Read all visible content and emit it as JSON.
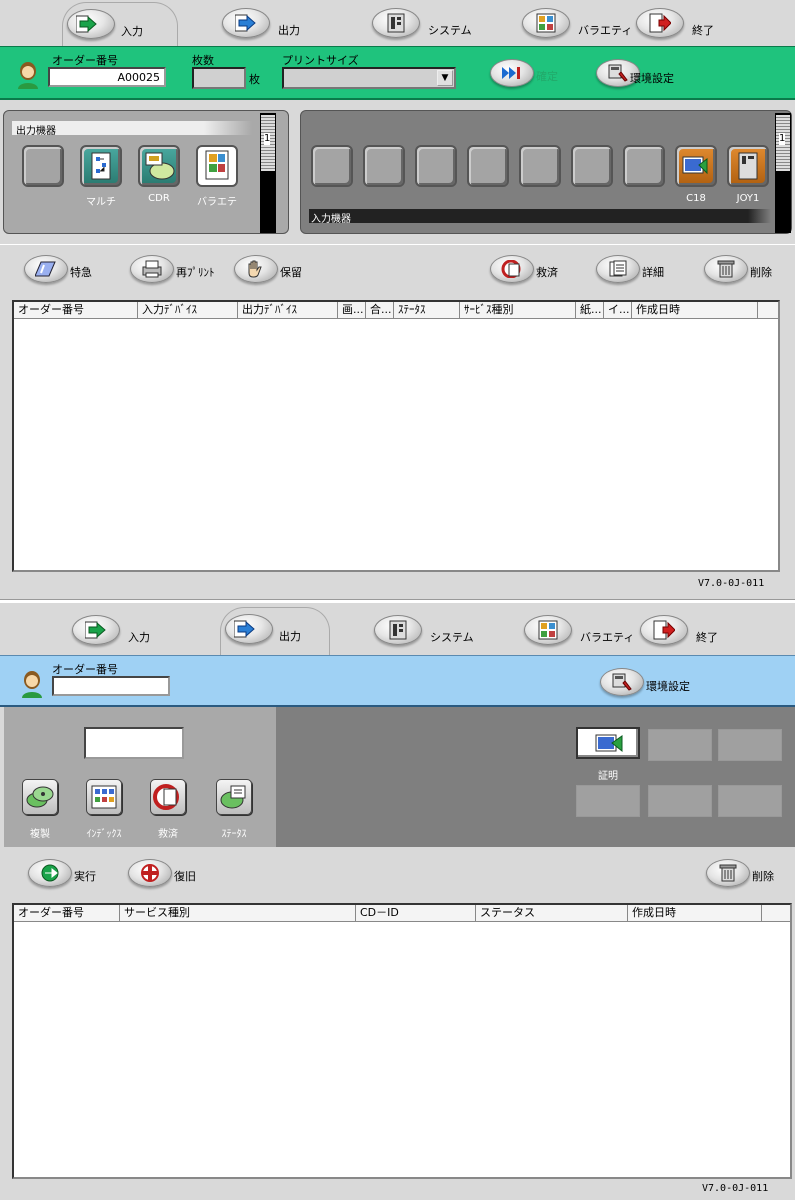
{
  "screen1": {
    "tabs": [
      {
        "label": "入力",
        "icon": "input-arrow-icon"
      },
      {
        "label": "出力",
        "icon": "output-arrow-icon"
      },
      {
        "label": "システム",
        "icon": "system-icon"
      },
      {
        "label": "バラエティ",
        "icon": "variety-icon"
      },
      {
        "label": "終了",
        "icon": "exit-icon"
      }
    ],
    "order": {
      "label": "オーダー番号",
      "value": "A00025"
    },
    "sheets": {
      "label": "枚数",
      "unit": "枚",
      "value": ""
    },
    "print_size": {
      "label": "プリントサイズ",
      "value": ""
    },
    "dim_button": {
      "label": "確定"
    },
    "env_button": {
      "label": "環境設定"
    },
    "output_devices": {
      "title": "出力機器",
      "items": [
        {
          "label": "",
          "icon": "blank-device-icon"
        },
        {
          "label": "マルチ",
          "icon": "multi-icon"
        },
        {
          "label": "CDR",
          "icon": "cdr-icon"
        },
        {
          "label": "バラエテ",
          "icon": "variety-icon"
        }
      ],
      "scroll_value": "1"
    },
    "input_devices": {
      "title": "入力機器",
      "items": [
        {
          "label": ""
        },
        {
          "label": ""
        },
        {
          "label": ""
        },
        {
          "label": ""
        },
        {
          "label": ""
        },
        {
          "label": ""
        },
        {
          "label": ""
        },
        {
          "label": "C18"
        },
        {
          "label": "JOY1"
        }
      ],
      "scroll_value": "1"
    },
    "actions": [
      {
        "label": "特急",
        "icon": "express-icon"
      },
      {
        "label": "再ﾌﾟﾘﾝﾄ",
        "icon": "reprint-icon"
      },
      {
        "label": "保留",
        "icon": "hold-hand-icon"
      },
      {
        "label": "救済",
        "icon": "rescue-icon"
      },
      {
        "label": "詳細",
        "icon": "detail-icon"
      },
      {
        "label": "削除",
        "icon": "trash-icon"
      }
    ],
    "table_headers": [
      "オーダー番号",
      "入力ﾃﾞﾊﾞｲｽ",
      "出力ﾃﾞﾊﾞｲｽ",
      "画...",
      "合...",
      "ｽﾃｰﾀｽ",
      "ｻｰﾋﾞｽ種別",
      "紙...",
      "イ...",
      "作成日時"
    ],
    "version": "V7.0-0J-011"
  },
  "screen2": {
    "tabs": [
      {
        "label": "入力"
      },
      {
        "label": "出力"
      },
      {
        "label": "システム"
      },
      {
        "label": "バラエティ"
      },
      {
        "label": "終了"
      }
    ],
    "order": {
      "label": "オーダー番号",
      "value": ""
    },
    "env_button": {
      "label": "環境設定"
    },
    "left_input_value": "",
    "services": [
      {
        "label": "複製",
        "icon": "copy-disc-icon"
      },
      {
        "label": "ｲﾝﾃﾞｯｸｽ",
        "icon": "index-icon"
      },
      {
        "label": "救済",
        "icon": "rescue-icon"
      },
      {
        "label": "ｽﾃｰﾀｽ",
        "icon": "status-disc-icon"
      }
    ],
    "media": [
      {
        "label": "証明",
        "icon": "id-photo-icon"
      }
    ],
    "actions": [
      {
        "label": "実行",
        "icon": "execute-arrow-icon"
      },
      {
        "label": "復旧",
        "icon": "recover-icon"
      },
      {
        "label": "削除",
        "icon": "trash-icon"
      }
    ],
    "table_headers": [
      "オーダー番号",
      "サービス種別",
      "CD－ID",
      "ステータス",
      "作成日時"
    ],
    "version": "V7.0-0J-011"
  },
  "colors": {
    "green_band": "#1fc37d",
    "blue_band": "#9fd1f4",
    "panel_gray": "#a9a9a9",
    "dark_panel": "#7f7f7f"
  }
}
